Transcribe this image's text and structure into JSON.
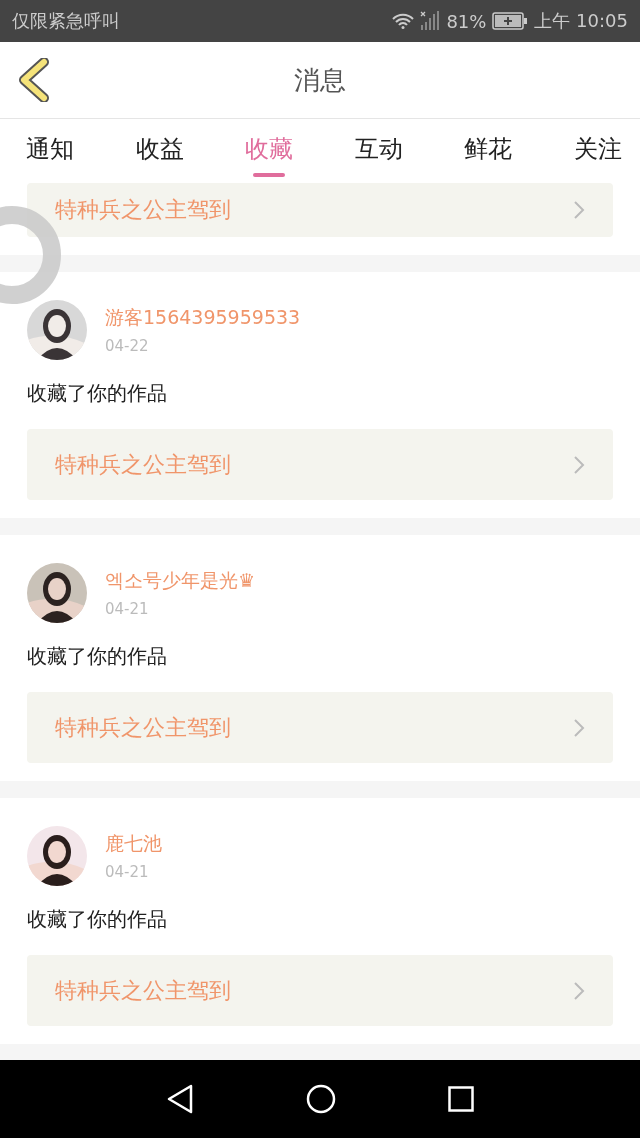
{
  "status_bar": {
    "notice": "仅限紧急呼叫",
    "battery": "81%",
    "time": "上午 10:05"
  },
  "header": {
    "title": "消息"
  },
  "tabs": [
    {
      "label": "通知",
      "selected": false
    },
    {
      "label": "收益",
      "selected": false
    },
    {
      "label": "收藏",
      "selected": true
    },
    {
      "label": "互动",
      "selected": false
    },
    {
      "label": "鲜花",
      "selected": false
    },
    {
      "label": "关注",
      "selected": false
    }
  ],
  "partial_item": {
    "work_title": "特种兵之公主驾到"
  },
  "items": [
    {
      "name": "游客1564395959533",
      "date": "04-22",
      "text": "收藏了你的作品",
      "work_title": "特种兵之公主驾到"
    },
    {
      "name": "엑소号少年是光♛",
      "date": "04-21",
      "text": "收藏了你的作品",
      "work_title": "特种兵之公主驾到"
    },
    {
      "name": "鹿七池",
      "date": "04-21",
      "text": "收藏了你的作品",
      "work_title": "特种兵之公主驾到"
    }
  ]
}
